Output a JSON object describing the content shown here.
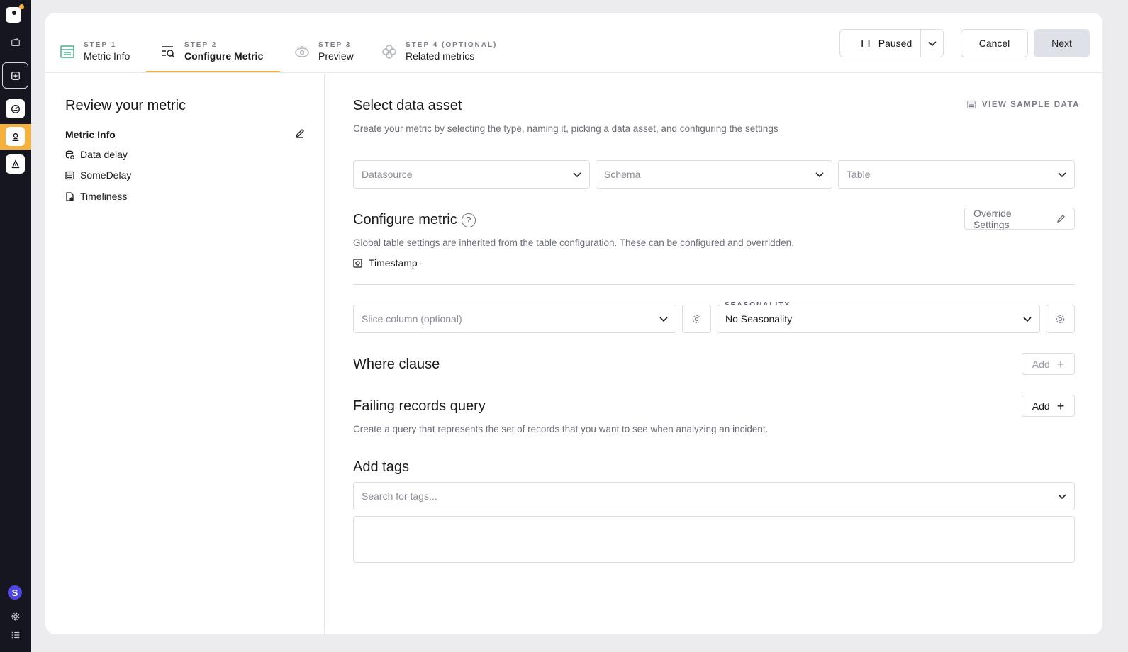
{
  "rail": {
    "icons": [
      "logo-icon",
      "wallet-icon",
      "frame-select-icon",
      "dashboard-icon",
      "monitor-icon",
      "alert-icon",
      "settings-icon",
      "list-icon"
    ],
    "avatar_letter": "S",
    "accent": "#f5b13d"
  },
  "steps": [
    {
      "label": "STEP 1",
      "name": "Metric Info",
      "icon": "table-icon"
    },
    {
      "label": "STEP 2",
      "name": "Configure Metric",
      "icon": "configure-search-icon"
    },
    {
      "label": "STEP 3",
      "name": "Preview",
      "icon": "eye-icon"
    },
    {
      "label": "STEP 4 (OPTIONAL)",
      "name": "Related metrics",
      "icon": "related-icon"
    }
  ],
  "header": {
    "status_label": "Paused",
    "cancel_label": "Cancel",
    "next_label": "Next"
  },
  "review": {
    "title": "Review your metric",
    "section": "Metric Info",
    "items": [
      {
        "label": "Data delay",
        "icon": "data-delay-icon"
      },
      {
        "label": "SomeDelay",
        "icon": "table-icon"
      },
      {
        "label": "Timeliness",
        "icon": "timeliness-icon"
      }
    ]
  },
  "data_asset": {
    "title": "Select data asset",
    "description": "Create your metric by selecting the type, naming it, picking a data asset, and configuring the settings",
    "view_sample": "VIEW SAMPLE DATA",
    "datasource_placeholder": "Datasource",
    "schema_placeholder": "Schema",
    "table_placeholder": "Table"
  },
  "configure": {
    "title": "Configure metric",
    "description": "Global table settings are inherited from the table configuration. These can be configured and overridden.",
    "override_label": "Override Settings",
    "timestamp_label": "Timestamp -",
    "slice_placeholder": "Slice column (optional)",
    "seasonality_label": "SEASONALITY",
    "seasonality_value": "No Seasonality"
  },
  "where_clause": {
    "title": "Where clause",
    "add_label": "Add"
  },
  "failing_records": {
    "title": "Failing records query",
    "add_label": "Add",
    "description": "Create a query that represents the set of records that you want to see when analyzing an incident."
  },
  "tags": {
    "title": "Add tags",
    "placeholder": "Search for tags..."
  }
}
